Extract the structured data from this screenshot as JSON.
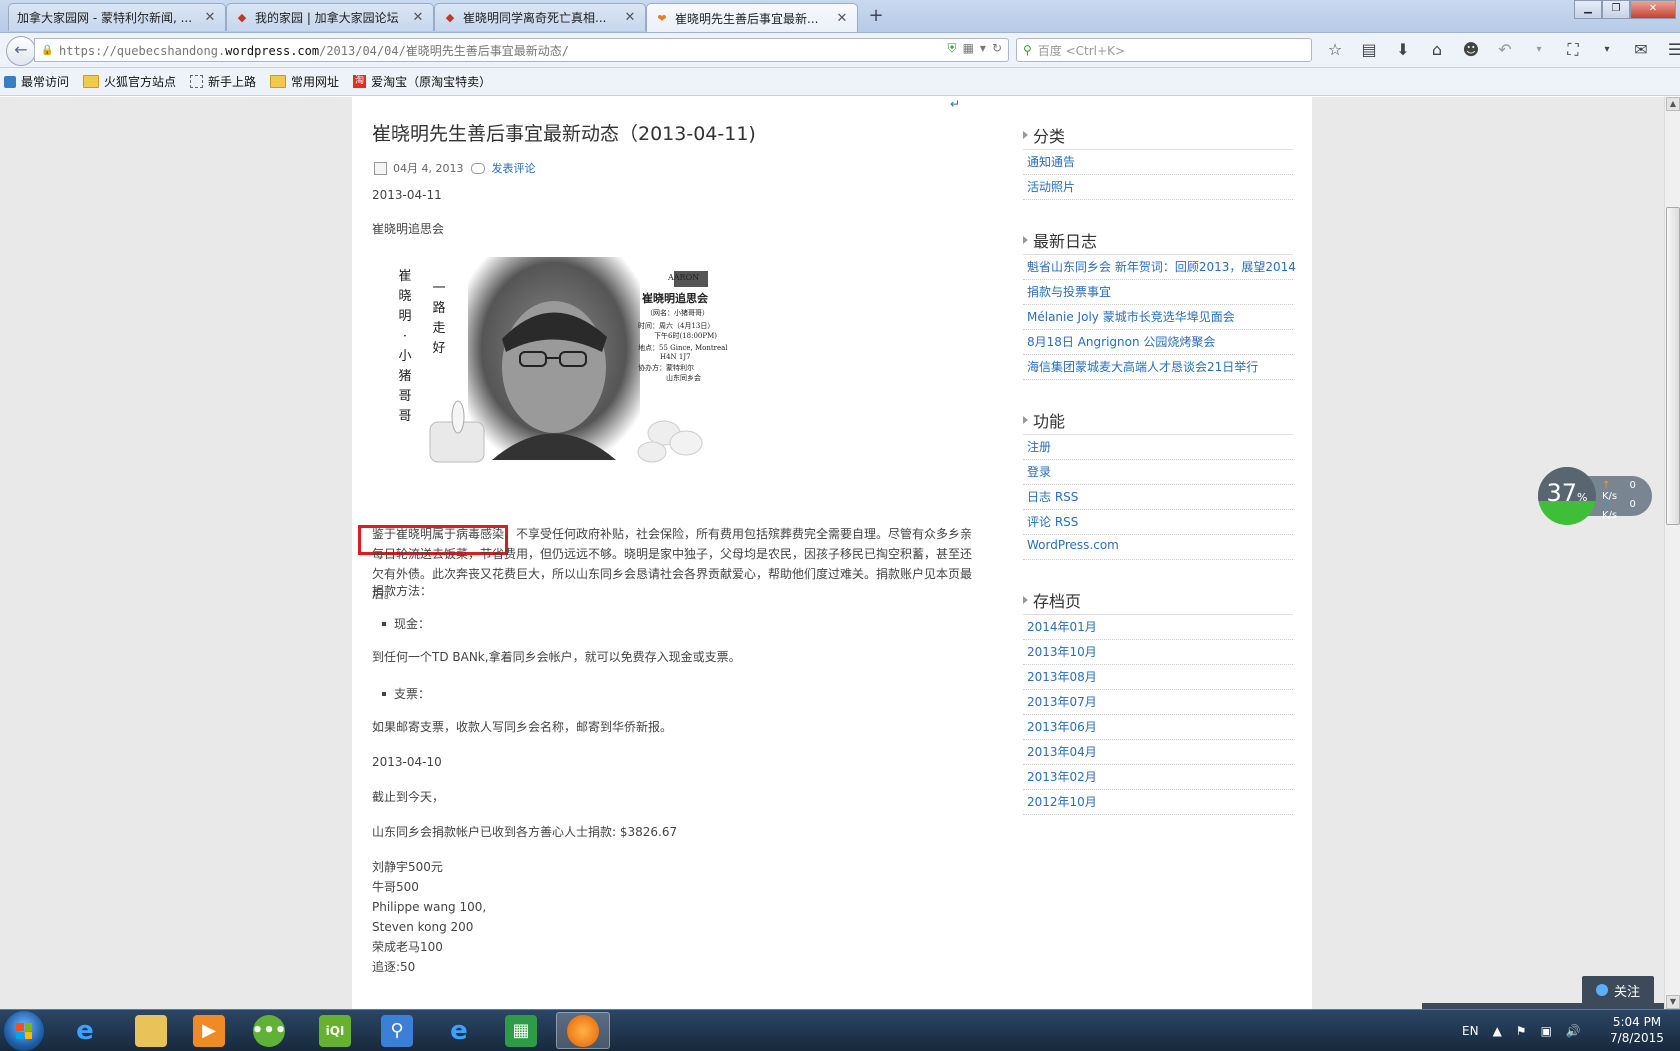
{
  "tabs": [
    {
      "title": "加拿大家园网 - 蒙特利尔新闻, ...",
      "active": false
    },
    {
      "title": "我的家园 | 加拿大家园论坛",
      "active": false
    },
    {
      "title": "崔晓明同学离奇死亡真相...",
      "active": false
    },
    {
      "title": "崔晓明先生善后事宜最新...",
      "active": true
    }
  ],
  "window_controls": {
    "minimize": "▁",
    "restore": "❐",
    "close": "✕"
  },
  "address_bar": {
    "url_prefix": "https://quebecshandong.",
    "url_domain": "wordpress.com",
    "url_path": "/2013/04/04/崔晓明先生善后事宜最新动态/"
  },
  "search_bar": {
    "placeholder": "百度 <Ctrl+K>"
  },
  "bookmarks": [
    "最常访问",
    "火狐官方站点",
    "新手上路",
    "常用网址",
    "爱淘宝（原淘宝特卖）"
  ],
  "post": {
    "title": "崔晓明先生善后事宜最新动态（2013-04-11)",
    "date": "04月 4, 2013",
    "comment_link": "发表评论",
    "date_heading_1": "2013-04-11",
    "memorial_label": "崔晓明追思会",
    "memorial_card": {
      "vertical_name": [
        "崔",
        "晓",
        "明",
        "·",
        "小",
        "猪",
        "哥",
        "哥"
      ],
      "vertical_farewell": [
        "一",
        "路",
        "走",
        "好"
      ],
      "org_logo": "AARON",
      "event_title": "崔晓明追思会",
      "nickname": "（网名：小猪哥哥）",
      "time_line_1": "时间：周六（4月13日）",
      "time_line_2": "下午6时(18:00PM)",
      "address_line_1": "地点：55 Gince, Montreal",
      "address_line_2": "H4N 1J7",
      "organizer_line_1": "协办方：蒙特利尔",
      "organizer_line_2": "山东同乡会"
    },
    "paragraph_1_highlighted": "鉴于崔晓明属于病毒感染",
    "paragraph_1_rest": "，不享受任何政府补贴，社会保险，所有费用包括殡葬费完全需要自理。尽管有众多乡亲每日轮流送去饭菜，节省费用，但仍远远不够。晓明是家中独子，父母均是农民，因孩子移民已掏空积蓄，甚至还欠有外债。此次奔丧又花费巨大，所以山东同乡会恳请社会各界贡献爱心，帮助他们度过难关。捐款账户见本页最后。",
    "donation_method": "捐款方法：",
    "cash_label": "现金：",
    "cash_text": "到任何一个TD BANk,拿着同乡会帐户，就可以免费存入现金或支票。",
    "cheque_label": "支票：",
    "cheque_text": "如果邮寄支票，收款人写同乡会名称，邮寄到华侨新报。",
    "date_heading_2": "2013-04-10",
    "as_of_today": "截止到今天，",
    "received_total": "山东同乡会捐款帐户已收到各方善心人士捐款: $3826.67",
    "donors": [
      "刘静宇500元",
      "牛哥500",
      "Philippe wang 100,",
      "Steven kong 200",
      "荣成老马100",
      "追逐:50"
    ]
  },
  "sidebar": {
    "categories": {
      "heading": "分类",
      "items": [
        "通知通告",
        "活动照片"
      ]
    },
    "recent_posts": {
      "heading": "最新日志",
      "items": [
        "魁省山东同乡会 新年贺词：回顾2013，展望2014",
        "捐款与投票事宜",
        "Mélanie Joly 蒙城市长竞选华埠见面会",
        "8月18日 Angrignon 公园烧烤聚会",
        "海信集团蒙城麦大高端人才恳谈会21日举行"
      ]
    },
    "meta": {
      "heading": "功能",
      "items": [
        "注册",
        "登录",
        "日志 RSS",
        "评论 RSS",
        "WordPress.com"
      ]
    },
    "archives": {
      "heading": "存档页",
      "items": [
        "2014年01月",
        "2013年10月",
        "2013年08月",
        "2013年07月",
        "2013年06月",
        "2013年04月",
        "2013年02月",
        "2012年10月"
      ]
    }
  },
  "speed_widget": {
    "percent": "37",
    "percent_sign": "%",
    "upload": "0 K/s",
    "download": "0 K/s",
    "load_fraction": 0.37
  },
  "follow_button": "关注",
  "taskbar": {
    "language": "EN",
    "time": "5:04 PM",
    "date": "7/8/2015"
  },
  "colors": {
    "link": "#2a6ebb",
    "highlight_box": "#e01b1b"
  }
}
